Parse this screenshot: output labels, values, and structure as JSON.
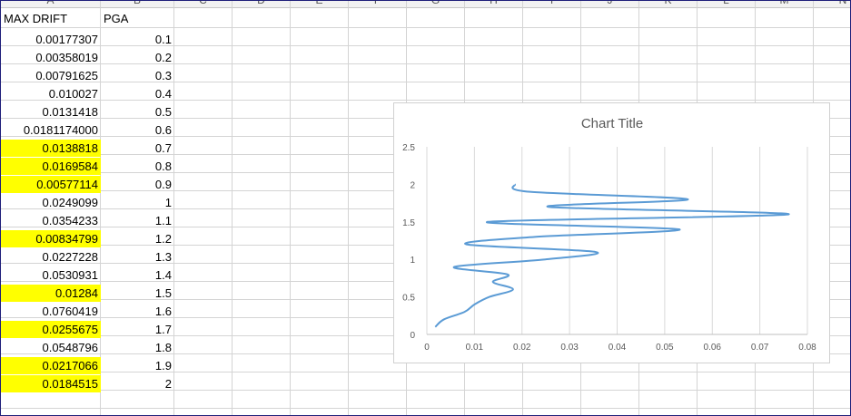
{
  "sheet": {
    "columns": [
      "A",
      "B",
      "C",
      "D",
      "E",
      "F",
      "G",
      "H",
      "I",
      "J",
      "K",
      "L",
      "M",
      "N"
    ],
    "headers": {
      "a1": "MAX DRIFT",
      "b1": "PGA"
    },
    "rows": [
      {
        "drift": "0.00177307",
        "pga": "0.1",
        "highlight": false
      },
      {
        "drift": "0.00358019",
        "pga": "0.2",
        "highlight": false
      },
      {
        "drift": "0.00791625",
        "pga": "0.3",
        "highlight": false
      },
      {
        "drift": "0.010027",
        "pga": "0.4",
        "highlight": false
      },
      {
        "drift": "0.0131418",
        "pga": "0.5",
        "highlight": false
      },
      {
        "drift": "0.0181174000",
        "pga": "0.6",
        "highlight": false
      },
      {
        "drift": "0.0138818",
        "pga": "0.7",
        "highlight": true
      },
      {
        "drift": "0.0169584",
        "pga": "0.8",
        "highlight": true
      },
      {
        "drift": "0.00577114",
        "pga": "0.9",
        "highlight": true
      },
      {
        "drift": "0.0249099",
        "pga": "1",
        "highlight": false
      },
      {
        "drift": "0.0354233",
        "pga": "1.1",
        "highlight": false
      },
      {
        "drift": "0.00834799",
        "pga": "1.2",
        "highlight": true
      },
      {
        "drift": "0.0227228",
        "pga": "1.3",
        "highlight": false
      },
      {
        "drift": "0.0530931",
        "pga": "1.4",
        "highlight": false
      },
      {
        "drift": "0.01284",
        "pga": "1.5",
        "highlight": true
      },
      {
        "drift": "0.0760419",
        "pga": "1.6",
        "highlight": false
      },
      {
        "drift": "0.0255675",
        "pga": "1.7",
        "highlight": true
      },
      {
        "drift": "0.0548796",
        "pga": "1.8",
        "highlight": false
      },
      {
        "drift": "0.0217066",
        "pga": "1.9",
        "highlight": true
      },
      {
        "drift": "0.0184515",
        "pga": "2",
        "highlight": true
      }
    ],
    "highlight_color": "#ffff00"
  },
  "chart_data": {
    "type": "scatter",
    "title": "Chart Title",
    "smooth_line": true,
    "line_color": "#5b9bd5",
    "xlim": [
      0,
      0.08
    ],
    "ylim": [
      0,
      2.5
    ],
    "x_ticks": [
      "0",
      "0.01",
      "0.02",
      "0.03",
      "0.04",
      "0.05",
      "0.06",
      "0.07",
      "0.08"
    ],
    "y_ticks": [
      "0",
      "0.5",
      "1",
      "1.5",
      "2",
      "2.5"
    ],
    "grid": "vertical",
    "series": [
      {
        "x": [
          0.00177307,
          0.00358019,
          0.00791625,
          0.010027,
          0.0131418,
          0.0181174,
          0.0138818,
          0.0169584,
          0.00577114,
          0.0249099,
          0.0354233,
          0.00834799,
          0.0227228,
          0.0530931,
          0.01284,
          0.0760419,
          0.0255675,
          0.0548796,
          0.0217066,
          0.0184515
        ],
        "y": [
          0.1,
          0.2,
          0.3,
          0.4,
          0.5,
          0.6,
          0.7,
          0.8,
          0.9,
          1.0,
          1.1,
          1.2,
          1.3,
          1.4,
          1.5,
          1.6,
          1.7,
          1.8,
          1.9,
          2.0
        ]
      }
    ]
  }
}
